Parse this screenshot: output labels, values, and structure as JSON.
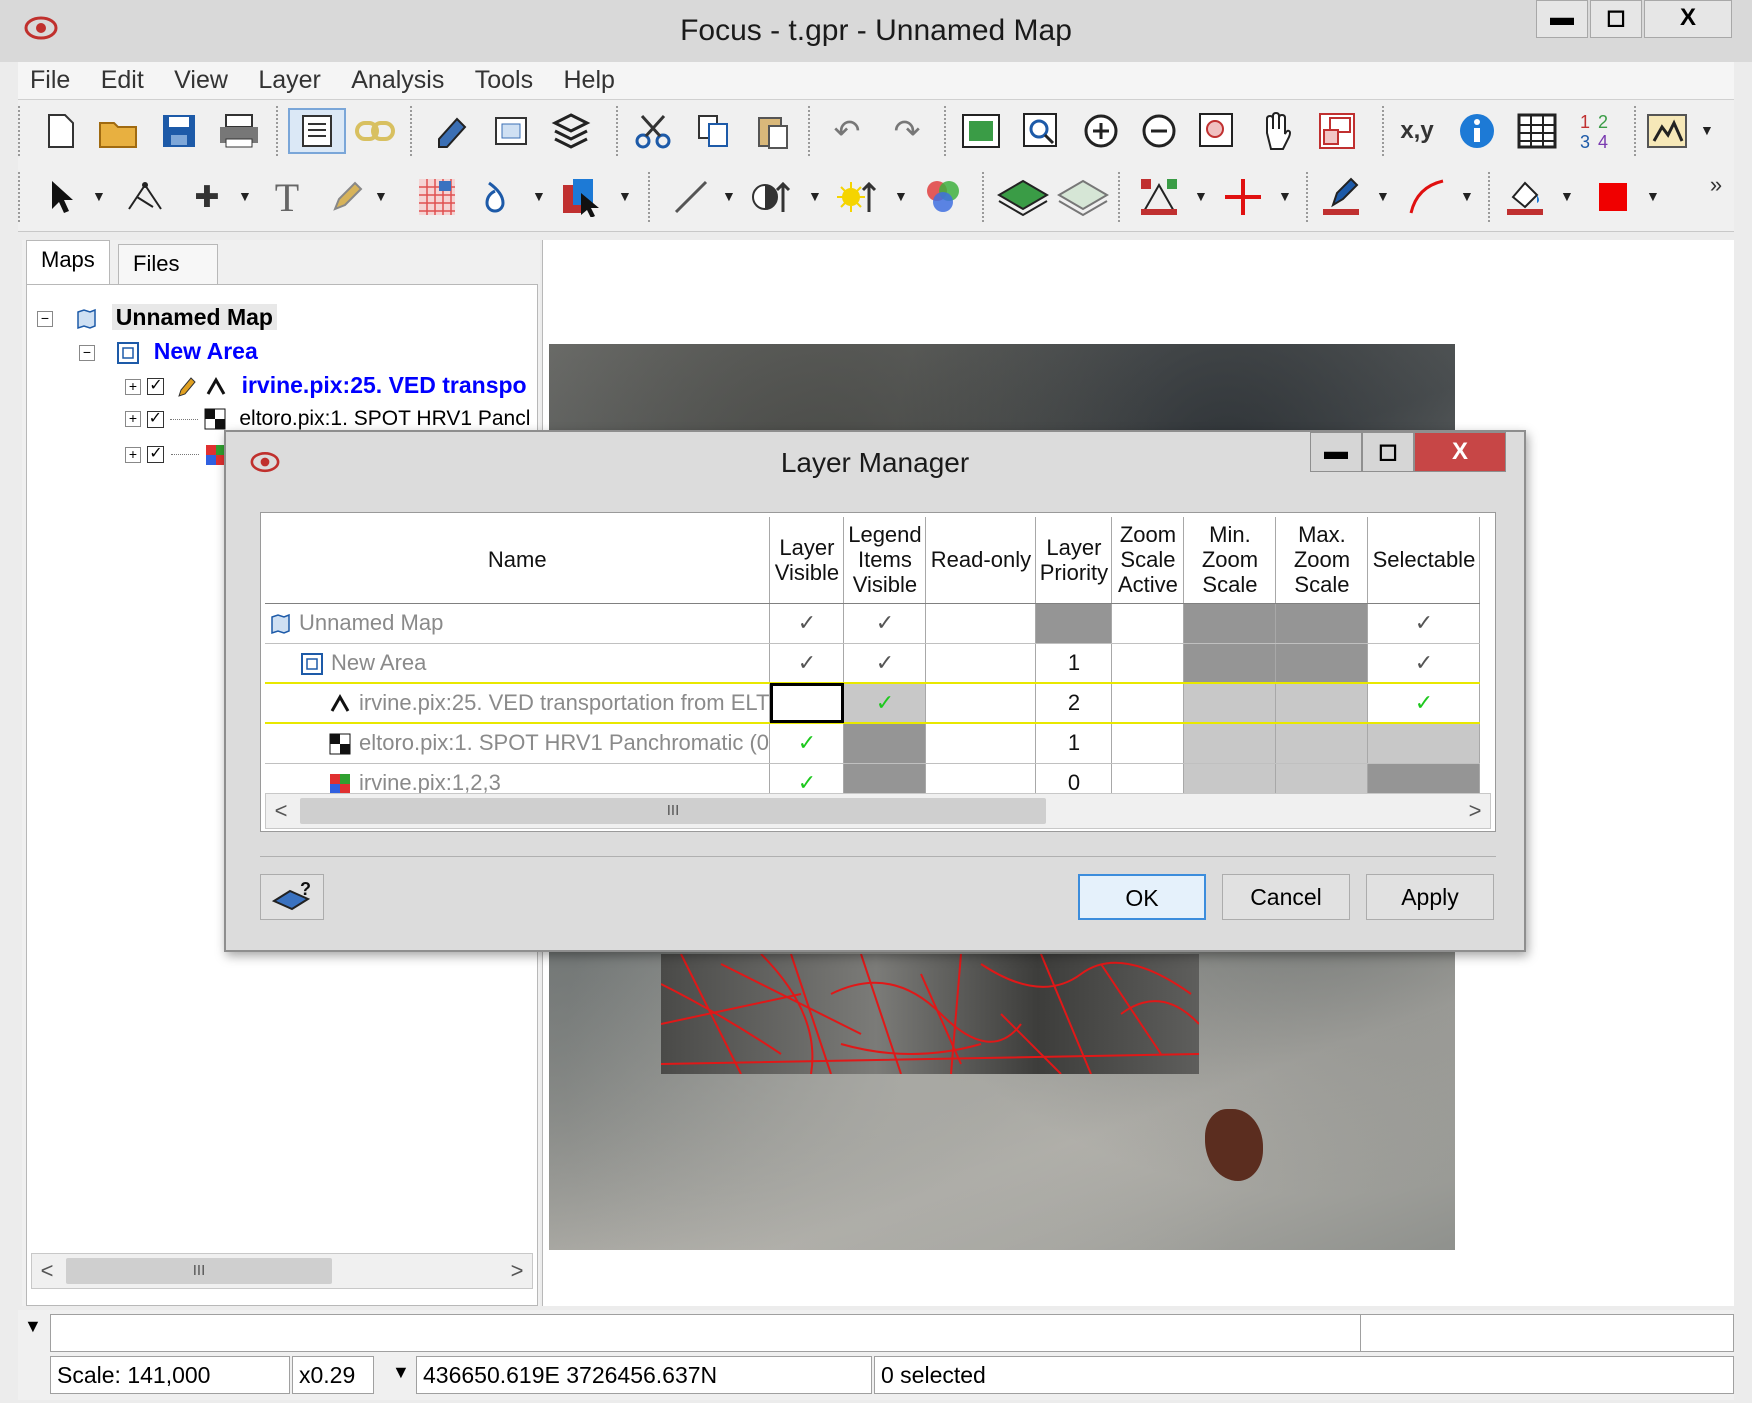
{
  "window": {
    "title": "Focus - t.gpr - Unnamed Map",
    "minimize": "▬",
    "maximize": "◻",
    "close": "X"
  },
  "menu": [
    "File",
    "Edit",
    "View",
    "Layer",
    "Analysis",
    "Tools",
    "Help"
  ],
  "tabs": {
    "maps": "Maps",
    "files": "Files"
  },
  "tree": {
    "root": "Unnamed Map",
    "area": "New Area",
    "layer1": "irvine.pix:25. VED transpo",
    "layer2": "eltoro.pix:1. SPOT HRV1 Pancl"
  },
  "toolbar_row1_extra": {
    "xy": "x,y",
    "nums": "1 2\n3 4"
  },
  "toolbar_overflow": "»",
  "layer_manager": {
    "title": "Layer Manager",
    "minimize": "▬",
    "maximize": "◻",
    "close": "X",
    "columns": [
      "Name",
      "Layer Visible",
      "Legend Items Visible",
      "Read-only",
      "Layer Priority",
      "Zoom Scale Active",
      "Min. Zoom Scale",
      "Max. Zoom Scale",
      "Selectable"
    ],
    "rows": [
      {
        "name": "Unnamed Map",
        "layer_visible": "✓",
        "legend_visible": "✓",
        "read_only": "",
        "priority": "",
        "zoom_active": "",
        "min_zoom": "",
        "max_zoom": "",
        "selectable": "✓"
      },
      {
        "name": "New Area",
        "layer_visible": "✓",
        "legend_visible": "✓",
        "read_only": "",
        "priority": "1",
        "zoom_active": "",
        "min_zoom": "",
        "max_zoom": "",
        "selectable": "✓"
      },
      {
        "name": "irvine.pix:25. VED transportation from ELT",
        "layer_visible": "",
        "legend_visible": "✓",
        "read_only": "",
        "priority": "2",
        "zoom_active": "",
        "min_zoom": "",
        "max_zoom": "",
        "selectable": "✓"
      },
      {
        "name": "eltoro.pix:1. SPOT HRV1 Panchromatic (0",
        "layer_visible": "✓",
        "legend_visible": "",
        "read_only": "",
        "priority": "1",
        "zoom_active": "",
        "min_zoom": "",
        "max_zoom": "",
        "selectable": ""
      },
      {
        "name": "irvine.pix:1,2,3",
        "layer_visible": "✓",
        "legend_visible": "",
        "read_only": "",
        "priority": "0",
        "zoom_active": "",
        "min_zoom": "",
        "max_zoom": "",
        "selectable": ""
      }
    ],
    "buttons": {
      "ok": "OK",
      "cancel": "Cancel",
      "apply": "Apply"
    },
    "scroll_thumb": "III"
  },
  "left_scroll_thumb": "III",
  "status": {
    "scale": "Scale: 141,000",
    "zoom": "x0.29",
    "coords": "436650.619E 3726456.637N",
    "selected": "0 selected"
  },
  "colors": {
    "accent": "#0000ff",
    "check_green": "#1ec81e",
    "close_red": "#c74646",
    "selected_row": "#e8e800"
  }
}
